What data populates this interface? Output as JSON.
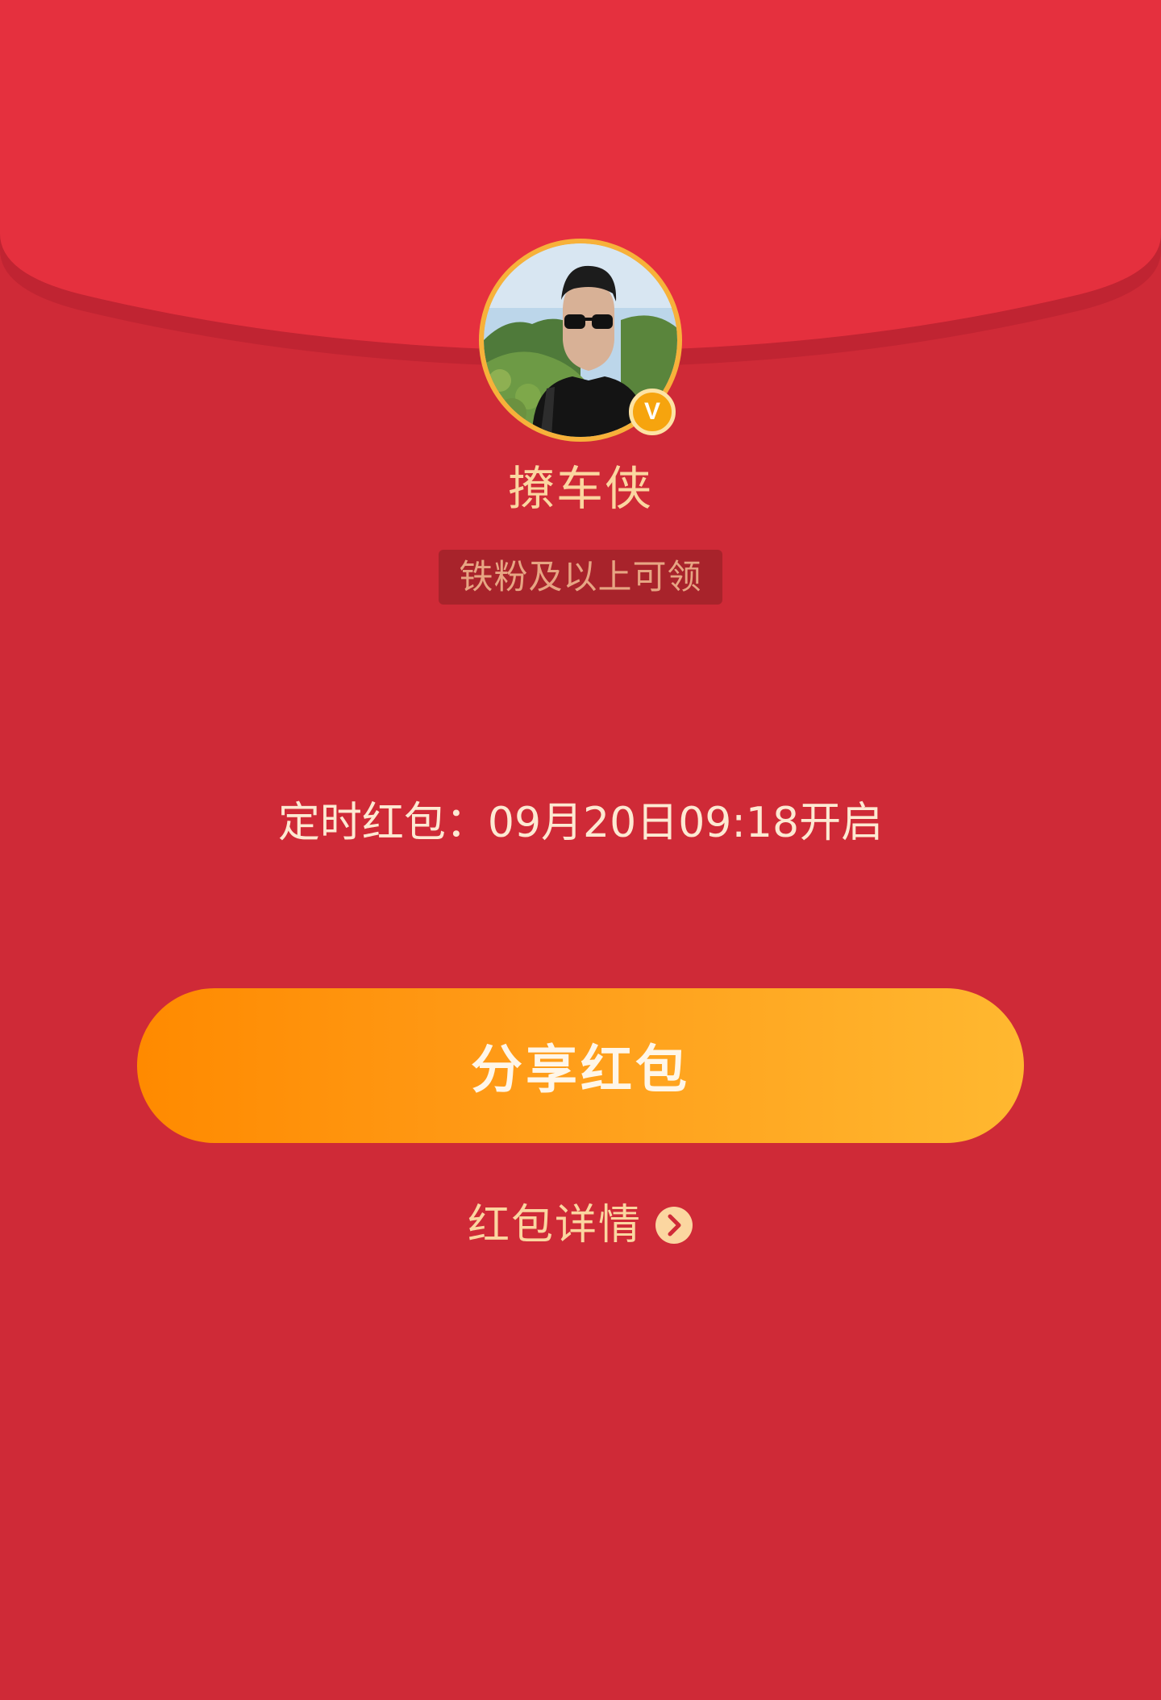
{
  "envelope": {
    "colors": {
      "flap": "#e5303e",
      "flap_shadow": "#c02432",
      "body": "#cf2a37",
      "accent_gold": "#f7b13a",
      "button_gradient_start": "#ff8a00",
      "button_gradient_end": "#ffb830"
    }
  },
  "sender": {
    "avatar_icon": "user-photo",
    "verified_icon": "verified-v-badge",
    "verified_label": "V",
    "name": "撩车侠"
  },
  "requirement": {
    "label": "铁粉及以上可领"
  },
  "schedule": {
    "text": "定时红包：09月20日09:18开启"
  },
  "actions": {
    "share_label": "分享红包",
    "details_label": "红包详情",
    "details_icon": "chevron-right-circle-icon"
  }
}
